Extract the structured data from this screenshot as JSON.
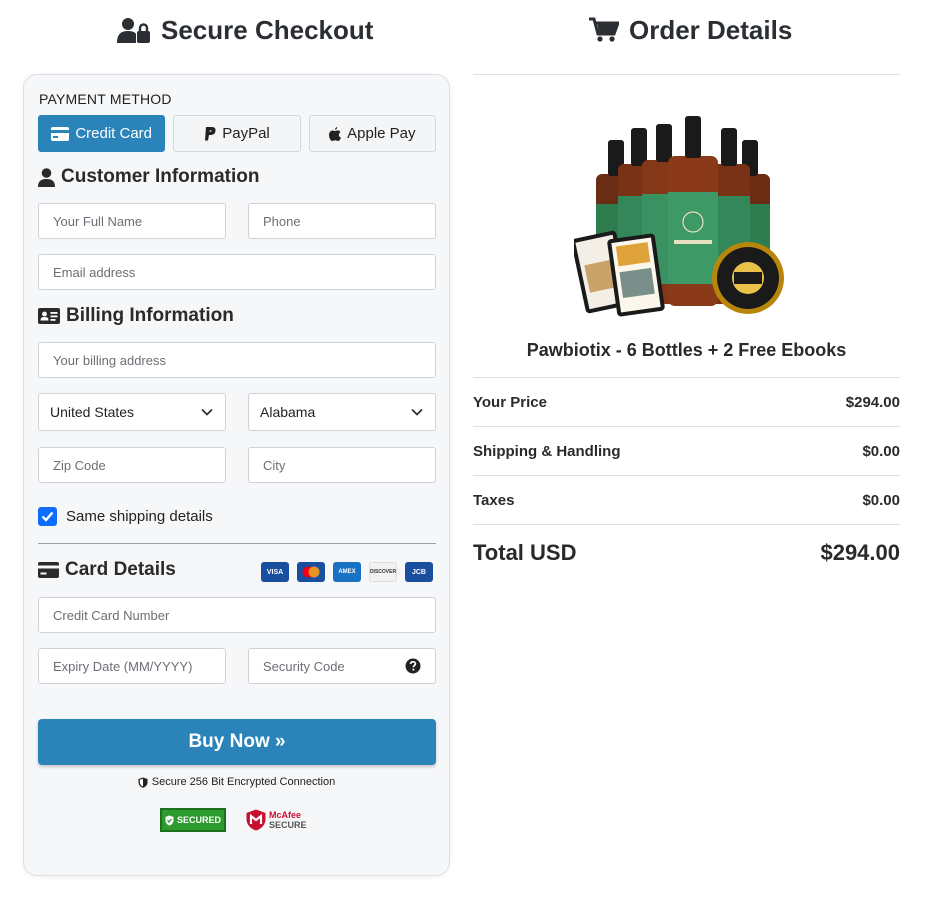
{
  "checkout": {
    "title": "Secure Checkout",
    "payment_method_label": "PAYMENT METHOD",
    "tabs": [
      {
        "label": "Credit Card",
        "icon": "credit-card-icon",
        "active": true
      },
      {
        "label": "PayPal",
        "icon": "paypal-icon",
        "active": false
      },
      {
        "label": "Apple Pay",
        "icon": "apple-icon",
        "active": false
      }
    ],
    "customer": {
      "heading": "Customer Information",
      "full_name_placeholder": "Your Full Name",
      "phone_placeholder": "Phone",
      "email_placeholder": "Email address"
    },
    "billing": {
      "heading": "Billing Information",
      "address_placeholder": "Your billing address",
      "country": "United States",
      "state": "Alabama",
      "zip_placeholder": "Zip Code",
      "city_placeholder": "City",
      "same_shipping_label": "Same shipping details",
      "same_shipping_checked": true
    },
    "card": {
      "heading": "Card Details",
      "logos": [
        "VISA",
        "mastercard",
        "AMEX",
        "DISCOVER",
        "JCB"
      ],
      "number_placeholder": "Credit Card Number",
      "expiry_placeholder": "Expiry Date (MM/YYYY)",
      "cvv_placeholder": "Security Code"
    },
    "buy_button": "Buy Now »",
    "secure_text": "Secure 256 Bit Encrypted Connection",
    "badges": {
      "trust": "SECURED",
      "mcafee_a": "McAfee",
      "mcafee_b": "SECURE"
    }
  },
  "order": {
    "title": "Order Details",
    "product_name": "Pawbiotix - 6 Bottles + 2 Free Ebooks",
    "rows": [
      {
        "label": "Your Price",
        "value": "$294.00"
      },
      {
        "label": "Shipping & Handling",
        "value": "$0.00"
      },
      {
        "label": "Taxes",
        "value": "$0.00"
      }
    ],
    "total_label": "Total USD",
    "total_value": "$294.00"
  },
  "colors": {
    "accent": "#2a84ba",
    "checkbox": "#0d6efd",
    "card_bg": "#f6f7f9"
  }
}
